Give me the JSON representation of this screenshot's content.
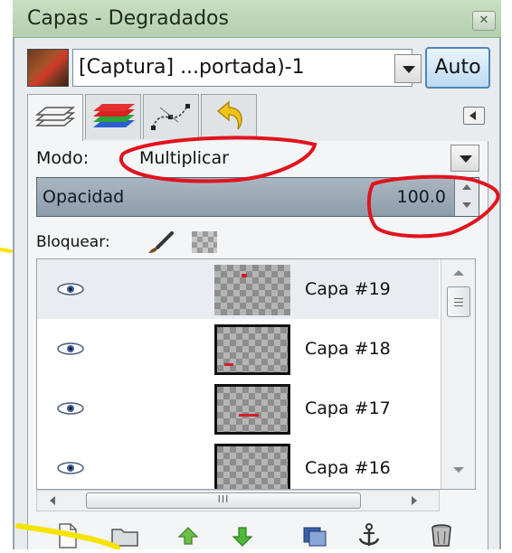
{
  "window": {
    "title": "Capas - Degradados",
    "close_icon": "close-icon"
  },
  "image_selector": {
    "name": "[Captura] ...portada)-1",
    "auto_label": "Auto"
  },
  "tabs": [
    {
      "id": "layers",
      "icon": "layers-stack-icon",
      "active": true
    },
    {
      "id": "channels",
      "icon": "channels-icon",
      "active": false
    },
    {
      "id": "paths",
      "icon": "paths-icon",
      "active": false
    },
    {
      "id": "undo",
      "icon": "undo-history-icon",
      "active": false
    }
  ],
  "mode": {
    "label": "Modo:",
    "value": "Multiplicar"
  },
  "opacity": {
    "label": "Opacidad",
    "value": "100.0"
  },
  "lock": {
    "label": "Bloquear:"
  },
  "layers": [
    {
      "name": "Capa #19",
      "visible": true,
      "selected": true
    },
    {
      "name": "Capa #18",
      "visible": true,
      "selected": false
    },
    {
      "name": "Capa #17",
      "visible": true,
      "selected": false
    },
    {
      "name": "Capa #16",
      "visible": true,
      "selected": false
    }
  ],
  "hscroll": {
    "grip": "III"
  },
  "toolbar": [
    {
      "icon": "new-layer-icon"
    },
    {
      "icon": "new-layer-group-icon"
    },
    {
      "icon": "raise-layer-icon"
    },
    {
      "icon": "lower-layer-icon"
    },
    {
      "icon": "duplicate-layer-icon"
    },
    {
      "icon": "anchor-layer-icon"
    },
    {
      "icon": "delete-layer-icon"
    }
  ],
  "colors": {
    "titlebar": "#b3cfae",
    "opacity_bar": "#8e9dab",
    "annotation_red": "#e0141e",
    "annotation_yellow": "#f5e400"
  }
}
